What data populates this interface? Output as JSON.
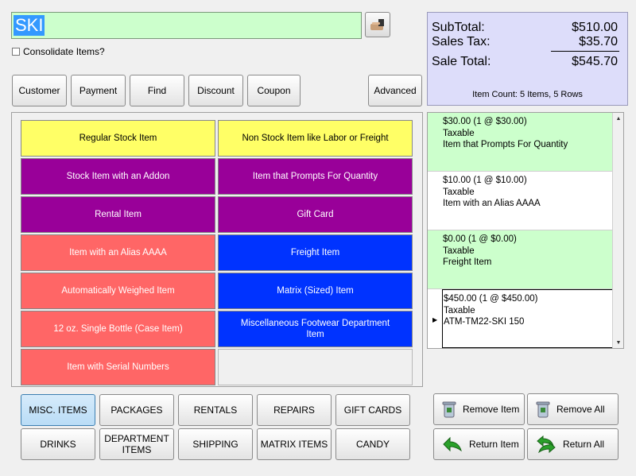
{
  "search": {
    "value": "SKI"
  },
  "consolidate": {
    "label": "Consolidate Items?"
  },
  "toolbar": {
    "customer": "Customer",
    "payment": "Payment",
    "find": "Find",
    "discount": "Discount",
    "coupon": "Coupon",
    "advanced": "Advanced"
  },
  "totals": {
    "subtotal_label": "SubTotal:",
    "subtotal_value": "$510.00",
    "tax_label": "Sales Tax:",
    "tax_value": "$35.70",
    "total_label": "Sale Total:",
    "total_value": "$545.70",
    "item_count": "Item Count: 5 Items, 5 Rows"
  },
  "tiles": [
    {
      "label": "Regular Stock Item",
      "bg": "#ffff66",
      "fg": "#000000"
    },
    {
      "label": "Non Stock Item like Labor or Freight",
      "bg": "#ffff66",
      "fg": "#000000"
    },
    {
      "label": "Stock Item with an Addon",
      "bg": "#990099",
      "fg": "#ffffff"
    },
    {
      "label": "Item that Prompts For Quantity",
      "bg": "#990099",
      "fg": "#ffffff"
    },
    {
      "label": "Rental Item",
      "bg": "#990099",
      "fg": "#ffffff"
    },
    {
      "label": "Gift Card",
      "bg": "#990099",
      "fg": "#ffffff"
    },
    {
      "label": "Item with an Alias AAAA",
      "bg": "#ff6666",
      "fg": "#ffffff"
    },
    {
      "label": "Freight Item",
      "bg": "#0033ff",
      "fg": "#ffffff"
    },
    {
      "label": "Automatically Weighed Item",
      "bg": "#ff6666",
      "fg": "#ffffff"
    },
    {
      "label": "Matrix (Sized) Item",
      "bg": "#0033ff",
      "fg": "#ffffff"
    },
    {
      "label": "12 oz. Single Bottle (Case Item)",
      "bg": "#ff6666",
      "fg": "#ffffff"
    },
    {
      "label": "Miscellaneous Footwear Department Item",
      "bg": "#0033ff",
      "fg": "#ffffff"
    },
    {
      "label": "Item with Serial Numbers",
      "bg": "#ff6666",
      "fg": "#ffffff"
    },
    {
      "label": "",
      "bg": "#f0f0f0",
      "fg": "#000000"
    }
  ],
  "cart": [
    {
      "price_line": "$30.00  (1 @ $30.00)",
      "tax": "Taxable",
      "name": "Item that Prompts For Quantity",
      "bg": "#ccffcc"
    },
    {
      "price_line": "$10.00  (1 @ $10.00)",
      "tax": "Taxable",
      "name": "Item with an Alias AAAA",
      "bg": "#ffffff"
    },
    {
      "price_line": "$0.00  (1 @ $0.00)",
      "tax": "Taxable",
      "name": "Freight Item",
      "bg": "#ccffcc"
    },
    {
      "price_line": "$450.00  (1 @ $450.00)",
      "tax": "Taxable",
      "name": "ATM-TM22-SKI 150",
      "bg": "#ffffff"
    }
  ],
  "categories": [
    "MISC. ITEMS",
    "PACKAGES",
    "RENTALS",
    "REPAIRS",
    "GIFT CARDS",
    "DRINKS",
    "DEPARTMENT ITEMS",
    "SHIPPING",
    "MATRIX ITEMS",
    "CANDY"
  ],
  "actions": {
    "remove_item": "Remove Item",
    "remove_all": "Remove All",
    "return_item": "Return Item",
    "return_all": "Return All"
  }
}
